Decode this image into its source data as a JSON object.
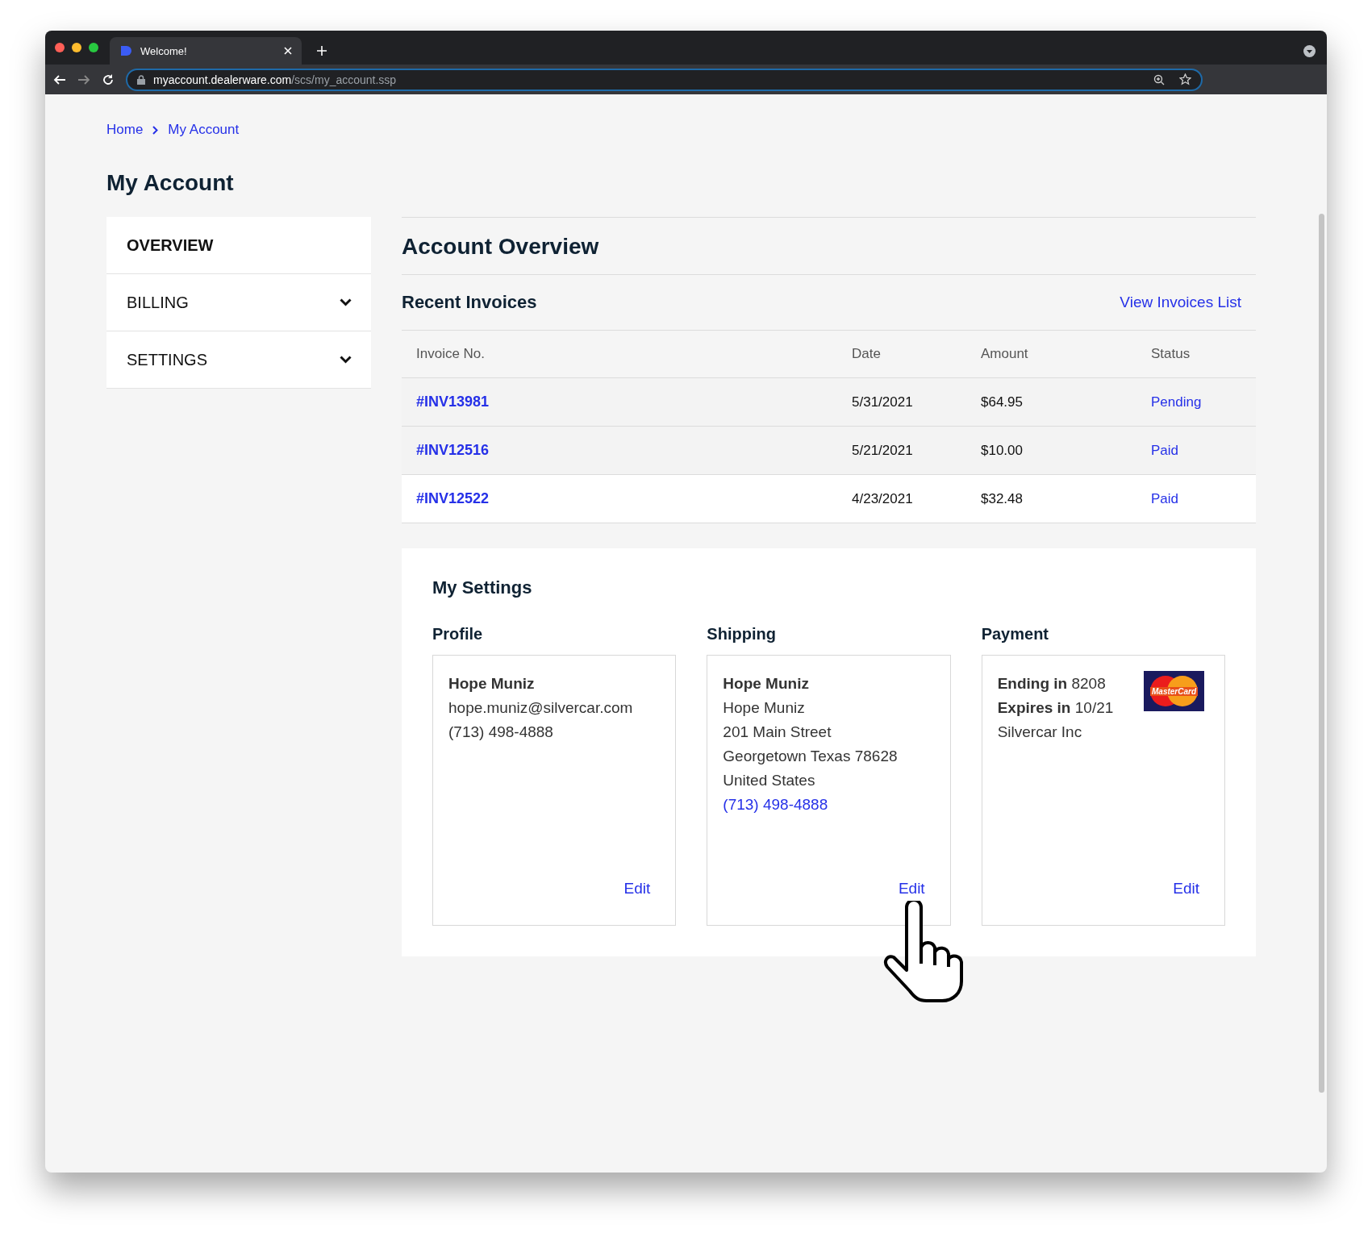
{
  "browser": {
    "tab_title": "Welcome!",
    "url_host": "myaccount.dealerware.com",
    "url_path": "/scs/my_account.ssp"
  },
  "breadcrumb": [
    "Home",
    "My Account"
  ],
  "page_title": "My Account",
  "sidebar": {
    "items": [
      {
        "label": "OVERVIEW",
        "selected": true,
        "expandable": false
      },
      {
        "label": "BILLING",
        "selected": false,
        "expandable": true
      },
      {
        "label": "SETTINGS",
        "selected": false,
        "expandable": true
      }
    ]
  },
  "overview": {
    "title": "Account Overview",
    "invoices_title": "Recent Invoices",
    "view_link": "View Invoices List",
    "table": {
      "columns": [
        "Invoice No.",
        "Date",
        "Amount",
        "Status"
      ],
      "rows": [
        {
          "invoice": "#INV13981",
          "date": "5/31/2021",
          "amount": "$64.95",
          "status": "Pending",
          "highlighted": false
        },
        {
          "invoice": "#INV12516",
          "date": "5/21/2021",
          "amount": "$10.00",
          "status": "Paid",
          "highlighted": false
        },
        {
          "invoice": "#INV12522",
          "date": "4/23/2021",
          "amount": "$32.48",
          "status": "Paid",
          "highlighted": true
        }
      ]
    }
  },
  "settings": {
    "title": "My Settings",
    "cards": [
      {
        "kind": "profile",
        "heading": "Profile",
        "lines": [
          {
            "text": "Hope Muniz",
            "kind": "name"
          },
          {
            "text": "hope.muniz@silvercar.com",
            "kind": "text"
          },
          {
            "text": "(713) 498-4888",
            "kind": "text"
          }
        ],
        "edit": "Edit"
      },
      {
        "kind": "shipping",
        "heading": "Shipping",
        "lines": [
          {
            "text": "Hope Muniz",
            "kind": "name"
          },
          {
            "text": "Hope Muniz",
            "kind": "text"
          },
          {
            "text": "201 Main Street",
            "kind": "text"
          },
          {
            "text": "Georgetown Texas 78628",
            "kind": "text"
          },
          {
            "text": "United States",
            "kind": "text"
          },
          {
            "text": "(713) 498-4888",
            "kind": "phone"
          }
        ],
        "edit": "Edit"
      },
      {
        "kind": "payment",
        "heading": "Payment",
        "lines": [
          {
            "text": "**Ending in** 8208",
            "kind": "text"
          },
          {
            "text": "**Expires in** 10/21",
            "kind": "text"
          },
          {
            "text": "Silvercar Inc",
            "kind": "text"
          }
        ],
        "card_brand": "MasterCard",
        "edit": "Edit"
      }
    ]
  }
}
